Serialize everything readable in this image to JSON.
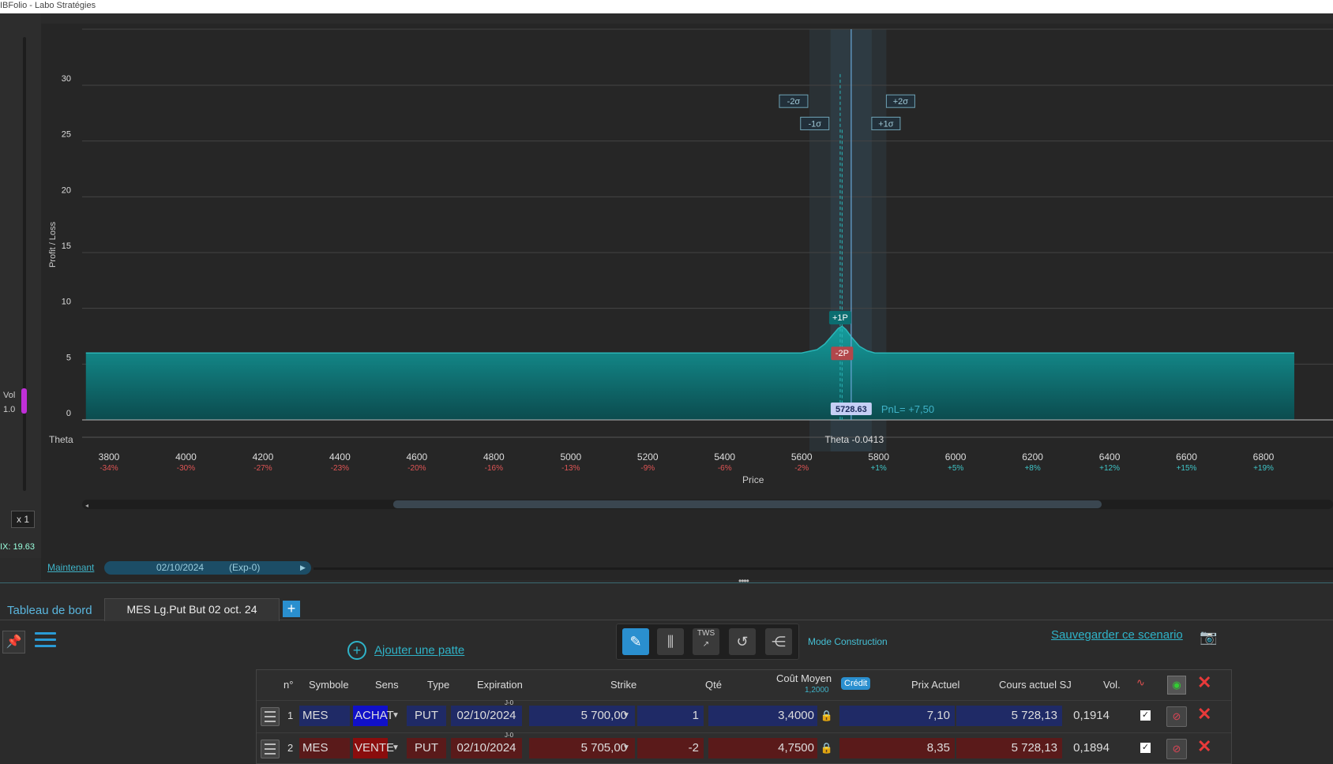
{
  "window": {
    "title": "IBFolio - Labo Stratégies"
  },
  "left_panel": {
    "vol_label": "Vol",
    "vol_value": "1.0",
    "zoom": "x 1",
    "vix": "IX: 19.63"
  },
  "chart_data": {
    "type": "area",
    "ylabel": "Profit / Loss",
    "xlabel": "Price",
    "xlim": [
      3720,
      6880
    ],
    "ylim": [
      -1,
      35
    ],
    "y_ticks": [
      0,
      5,
      10,
      15,
      20,
      25,
      30
    ],
    "x_ticks": [
      {
        "value": 3800,
        "pct": "-34%"
      },
      {
        "value": 4000,
        "pct": "-30%"
      },
      {
        "value": 4200,
        "pct": "-27%"
      },
      {
        "value": 4400,
        "pct": "-23%"
      },
      {
        "value": 4600,
        "pct": "-20%"
      },
      {
        "value": 4800,
        "pct": "-16%"
      },
      {
        "value": 5000,
        "pct": "-13%"
      },
      {
        "value": 5200,
        "pct": "-9%"
      },
      {
        "value": 5400,
        "pct": "-6%"
      },
      {
        "value": 5600,
        "pct": "-2%"
      },
      {
        "value": 5800,
        "pct": "+1%"
      },
      {
        "value": 6000,
        "pct": "+5%"
      },
      {
        "value": 6200,
        "pct": "+8%"
      },
      {
        "value": 6400,
        "pct": "+12%"
      },
      {
        "value": 6600,
        "pct": "+15%"
      },
      {
        "value": 6800,
        "pct": "+19%"
      }
    ],
    "pnl_curve": {
      "x": [
        3740,
        5600,
        5640,
        5660,
        5680,
        5695,
        5705,
        5715,
        5730,
        5750,
        5770,
        5790,
        6880
      ],
      "y": [
        6.0,
        6.0,
        6.3,
        6.8,
        7.6,
        8.2,
        8.4,
        8.1,
        7.4,
        6.6,
        6.2,
        6.0,
        6.0
      ]
    },
    "current_price": 5728.63,
    "current_price_label": "5728.63",
    "pnl_label": "PnL= +7,50",
    "theta_label": "Theta",
    "theta_value": "Theta -0.0413",
    "sigma_bands": [
      {
        "label": "-2σ",
        "value": 5620
      },
      {
        "label": "-1σ",
        "value": 5675
      },
      {
        "label": "+1σ",
        "value": 5782
      },
      {
        "label": "+2σ",
        "value": 5820
      }
    ],
    "strike_markers": [
      {
        "label": "+1P",
        "value": 5700,
        "y": 9.2
      },
      {
        "label": "-2P",
        "value": 5705,
        "y": 6.0
      }
    ],
    "colors": {
      "fill": "#0f7e80",
      "fill_top": "#14a3a3",
      "line": "#2ab6b8",
      "price_line": "#6aa8d8",
      "marker_buy": "#0c6d70",
      "marker_sell": "#b2474b"
    }
  },
  "timeline": {
    "now_label": "Maintenant",
    "date": "02/10/2024",
    "exp": "(Exp-0)"
  },
  "tabs": [
    {
      "label": "Tableau de bord"
    },
    {
      "label": "MES Lg.Put But 02 oct. 24"
    }
  ],
  "actions": {
    "add_leg": "Ajouter une patte",
    "mode": "Mode Construction",
    "save": "Sauvegarder ce scenario",
    "tws": "TWS"
  },
  "table": {
    "headers": {
      "n": "n°",
      "symbole": "Symbole",
      "sens": "Sens",
      "type": "Type",
      "expiration": "Expiration",
      "strike": "Strike",
      "qte": "Qté",
      "cout": "Coût Moyen",
      "cout_sub": "1,2000",
      "credit": "Crédit",
      "prix": "Prix Actuel",
      "cours": "Cours actuel SJ",
      "vol": "Vol."
    },
    "rows": [
      {
        "n": "1",
        "symbol": "MES",
        "sens": "ACHAT",
        "type": "PUT",
        "exp_tag": "J-0",
        "expiration": "02/10/2024",
        "strike": "5 700,00",
        "qty": "1",
        "cost": "3,4000",
        "price": "7,10",
        "underlying": "5 728,13",
        "vol": "0,1914"
      },
      {
        "n": "2",
        "symbol": "MES",
        "sens": "VENTE",
        "type": "PUT",
        "exp_tag": "J-0",
        "expiration": "02/10/2024",
        "strike": "5 705,00",
        "qty": "-2",
        "cost": "4,7500",
        "price": "8,35",
        "underlying": "5 728,13",
        "vol": "0,1894"
      }
    ],
    "row_colors": {
      "buy": "#1f2a66",
      "sell": "#5a1a1a",
      "buy_badge": "#1010c8",
      "sell_badge": "#8a0d0d"
    }
  }
}
